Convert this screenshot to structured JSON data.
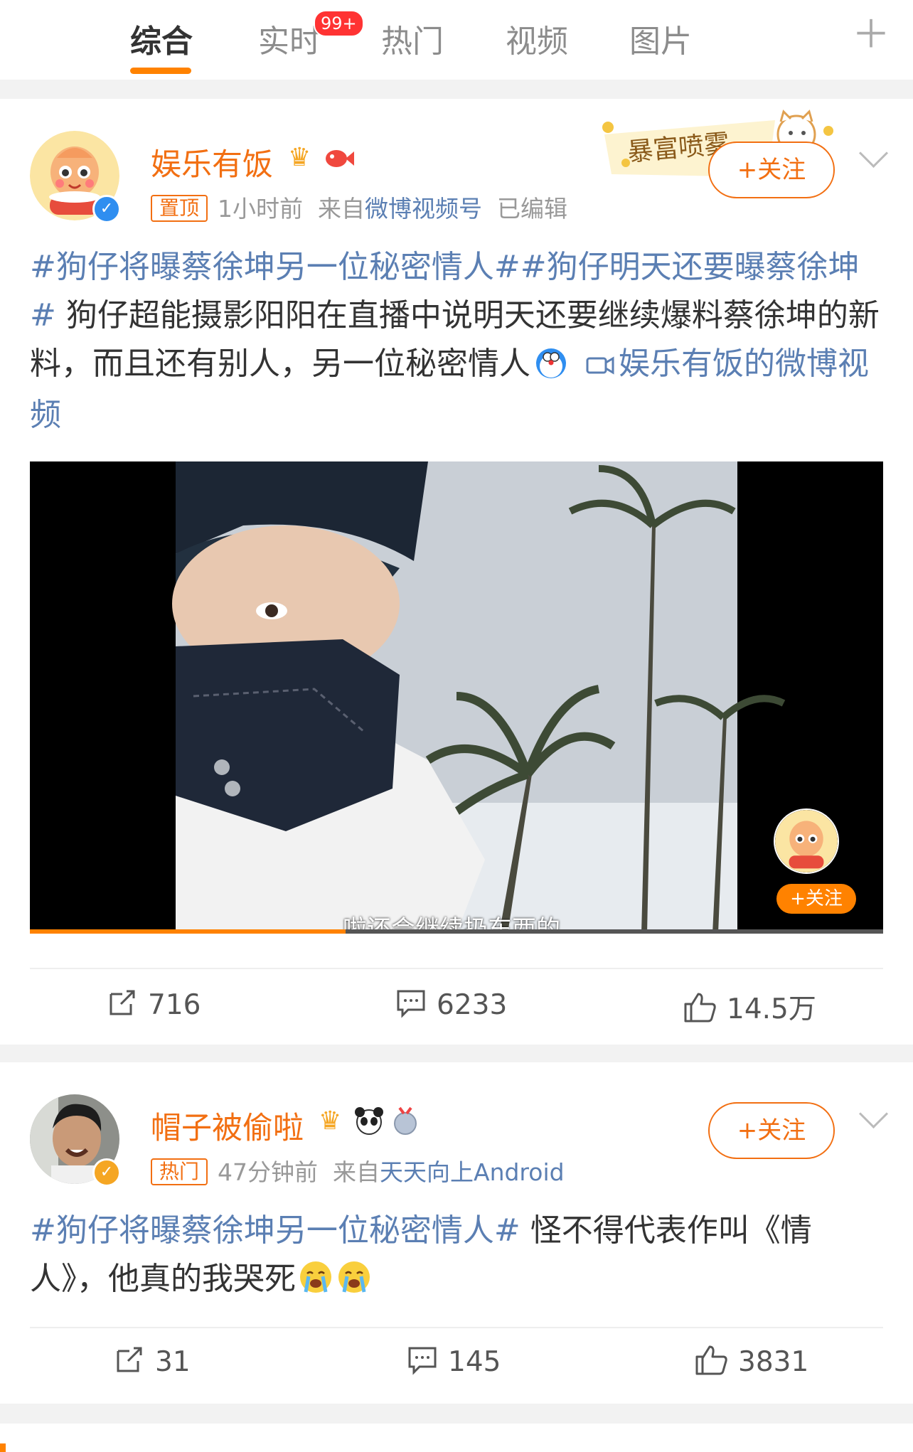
{
  "tabs": [
    {
      "label": "综合",
      "active": true
    },
    {
      "label": "实时",
      "badge": "99+"
    },
    {
      "label": "热门"
    },
    {
      "label": "视频"
    },
    {
      "label": "图片"
    }
  ],
  "posts": [
    {
      "username": "娱乐有饭",
      "tag": "置顶",
      "time": "1小时前",
      "from_prefix": "来自",
      "source": "微博视频号",
      "edited": "已编辑",
      "follow_label": "+关注",
      "banner_text": "暴富喷雾",
      "topic1": "#狗仔将曝蔡徐坤另一位秘密情人#",
      "topic2": "#狗仔明天还要曝蔡徐坤#",
      "body": " 狗仔超能摄影阳阳在直播中说明天还要继续爆料蔡徐坤的新料，而且还有别人，另一位秘密情人",
      "video_link": "娱乐有饭的微博视频",
      "video": {
        "subtitle": "啦还会继续扔东西的",
        "overlay_follow": "+关注",
        "progress": 0.37
      },
      "reposts": "716",
      "comments": "6233",
      "likes": "14.5万"
    },
    {
      "username": "帽子被偷啦",
      "tag": "热门",
      "time": "47分钟前",
      "from_prefix": "来自",
      "source": "天天向上Android",
      "follow_label": "+关注",
      "topic1": "#狗仔将曝蔡徐坤另一位秘密情人#",
      "body": " 怪不得代表作叫《情人》，他真的我哭死",
      "reposts": "31",
      "comments": "145",
      "likes": "3831"
    }
  ],
  "colors": {
    "accent": "#ff8200",
    "link": "#5b7fb3",
    "name": "#f26f12"
  }
}
